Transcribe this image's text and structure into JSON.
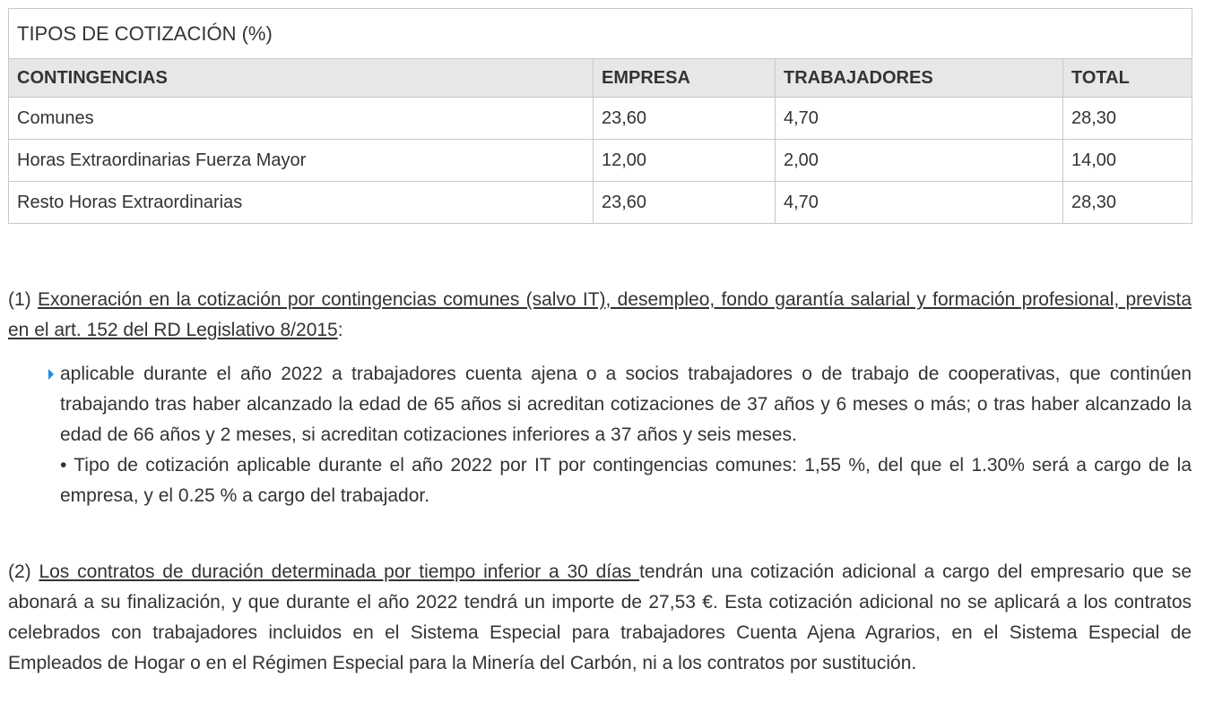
{
  "table": {
    "title": "TIPOS DE COTIZACIÓN (%)",
    "headers": [
      "CONTINGENCIAS",
      "EMPRESA",
      "TRABAJADORES",
      "TOTAL"
    ],
    "rows": [
      [
        "Comunes",
        "23,60",
        "4,70",
        "28,30"
      ],
      [
        "Horas Extraordinarias Fuerza Mayor",
        "12,00",
        "2,00",
        "14,00"
      ],
      [
        "Resto Horas Extraordinarias",
        "23,60",
        "4,70",
        "28,30"
      ]
    ]
  },
  "note1": {
    "number": "(1) ",
    "underlined": "Exoneración  en la cotización por contingencias comunes (salvo IT), desempleo, fondo garantía salarial y formación profesional, prevista en el art. 152 del RD Legislativo 8/2015",
    "tail": ":",
    "bullet": "aplicable durante el año 2022 a trabajadores cuenta ajena o a socios trabajadores o de trabajo de cooperativas, que continúen trabajando tras haber alcanzado la edad de 65 años si acreditan cotizaciones de 37 años y 6 meses o más; o tras haber alcanzado la edad de 66 años y 2 meses, si acreditan cotizaciones inferiores a 37 años y seis meses.",
    "subpoint": "• Tipo de cotización aplicable durante el año 2022 por IT por contingencias comunes:   1,55 %, del que el 1.30% será a cargo de la empresa, y el 0.25 % a cargo del trabajador."
  },
  "note2": {
    "number": "(2)  ",
    "underlined": " Los contratos de duración determinada por tiempo inferior a 30 días ",
    "rest": "tendrán una cotización adicional a cargo del empresario que se abonará a su finalización, y que durante el año 2022 tendrá un importe de 27,53 €.   Esta cotización adicional no se aplicará a los contratos celebrados con trabajadores incluidos en el Sistema Especial para trabajadores Cuenta Ajena Agrarios, en el Sistema Especial de Empleados de Hogar o en el Régimen Especial para la Minería del Carbón, ni a los contratos por sustitución."
  },
  "colors": {
    "bullet": "#1e88e5",
    "header_bg": "#e7e7e7",
    "border": "#c8c8c8",
    "text": "#333333"
  }
}
